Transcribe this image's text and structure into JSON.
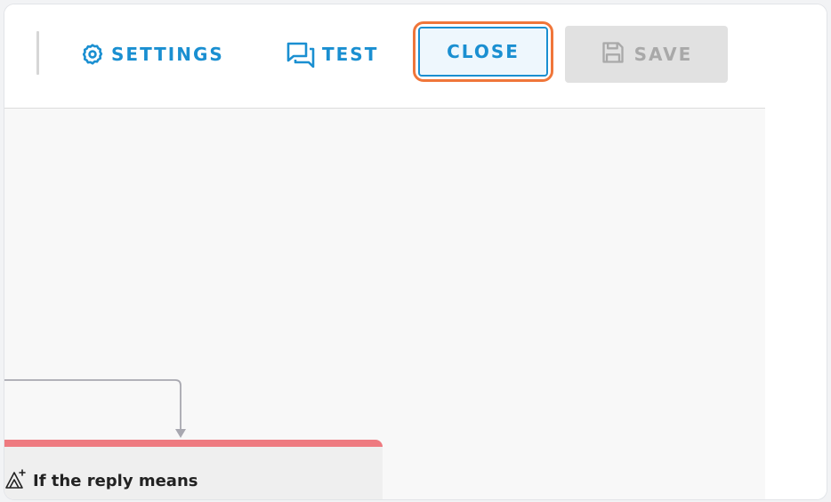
{
  "toolbar": {
    "settings_label": "SETTINGS",
    "test_label": "TEST",
    "close_label": "CLOSE",
    "save_label": "SAVE",
    "icons": {
      "settings": "gear-icon",
      "test": "chat-bubbles-icon",
      "save": "floppy-disk-icon"
    }
  },
  "flow": {
    "node_title": "If the reply means",
    "node_icon": "ai-condition-icon",
    "node_accent_color": "#ee7a80"
  },
  "colors": {
    "accent": "#1a8fd1",
    "highlight": "#f0763a",
    "disabled": "#a9a9a9"
  }
}
